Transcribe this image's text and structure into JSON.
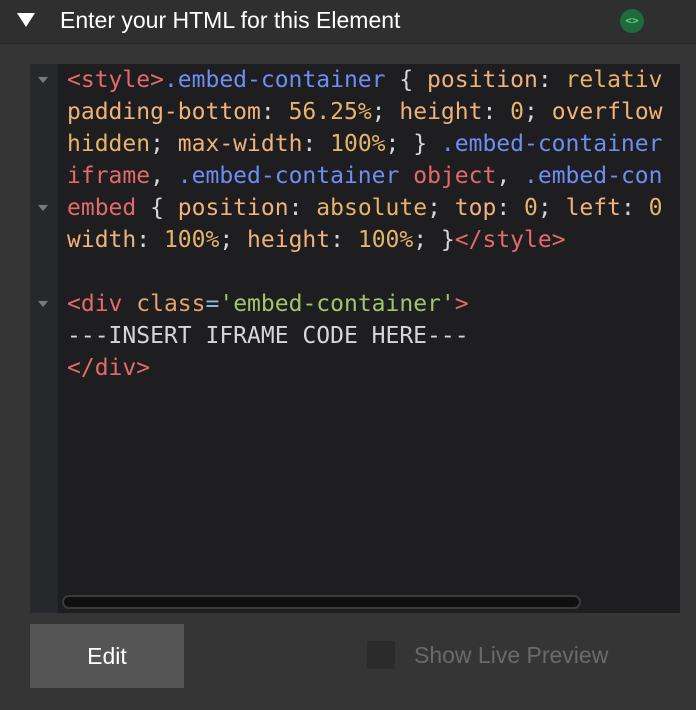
{
  "header": {
    "title": "Enter your HTML for this Element",
    "collapse_icon": "triangle-down-icon",
    "badge_icon": "code-brackets-icon",
    "badge_glyph": "<>",
    "badge_color": "#1f6b3c"
  },
  "editor": {
    "lines": [
      [
        {
          "t": "tag",
          "s": "<style>"
        },
        {
          "t": "cls",
          "s": ".embed-container"
        },
        {
          "t": "plain",
          "s": " { "
        },
        {
          "t": "prop",
          "s": "position"
        },
        {
          "t": "plain",
          "s": ": "
        },
        {
          "t": "val",
          "s": "relativ"
        }
      ],
      [
        {
          "t": "prop",
          "s": "padding-bottom"
        },
        {
          "t": "plain",
          "s": ": "
        },
        {
          "t": "val",
          "s": "56.25%"
        },
        {
          "t": "plain",
          "s": "; "
        },
        {
          "t": "prop",
          "s": "height"
        },
        {
          "t": "plain",
          "s": ": "
        },
        {
          "t": "val",
          "s": "0"
        },
        {
          "t": "plain",
          "s": "; "
        },
        {
          "t": "prop",
          "s": "overflow"
        }
      ],
      [
        {
          "t": "val",
          "s": "hidden"
        },
        {
          "t": "plain",
          "s": "; "
        },
        {
          "t": "prop",
          "s": "max-width"
        },
        {
          "t": "plain",
          "s": ": "
        },
        {
          "t": "val",
          "s": "100%"
        },
        {
          "t": "plain",
          "s": "; } "
        },
        {
          "t": "cls",
          "s": ".embed-container"
        }
      ],
      [
        {
          "t": "tag",
          "s": "iframe"
        },
        {
          "t": "plain",
          "s": ", "
        },
        {
          "t": "cls",
          "s": ".embed-container"
        },
        {
          "t": "plain",
          "s": " "
        },
        {
          "t": "tag",
          "s": "object"
        },
        {
          "t": "plain",
          "s": ", "
        },
        {
          "t": "cls",
          "s": ".embed-con"
        }
      ],
      [
        {
          "t": "tag",
          "s": "embed"
        },
        {
          "t": "plain",
          "s": " { "
        },
        {
          "t": "prop",
          "s": "position"
        },
        {
          "t": "plain",
          "s": ": "
        },
        {
          "t": "val",
          "s": "absolute"
        },
        {
          "t": "plain",
          "s": "; "
        },
        {
          "t": "prop",
          "s": "top"
        },
        {
          "t": "plain",
          "s": ": "
        },
        {
          "t": "val",
          "s": "0"
        },
        {
          "t": "plain",
          "s": "; "
        },
        {
          "t": "prop",
          "s": "left"
        },
        {
          "t": "plain",
          "s": ": "
        },
        {
          "t": "val",
          "s": "0"
        }
      ],
      [
        {
          "t": "prop",
          "s": "width"
        },
        {
          "t": "plain",
          "s": ": "
        },
        {
          "t": "val",
          "s": "100%"
        },
        {
          "t": "plain",
          "s": "; "
        },
        {
          "t": "prop",
          "s": "height"
        },
        {
          "t": "plain",
          "s": ": "
        },
        {
          "t": "val",
          "s": "100%"
        },
        {
          "t": "plain",
          "s": "; }"
        },
        {
          "t": "tag",
          "s": "</style>"
        }
      ],
      [],
      [
        {
          "t": "tag",
          "s": "<div"
        },
        {
          "t": "plain",
          "s": " "
        },
        {
          "t": "attr",
          "s": "class"
        },
        {
          "t": "op",
          "s": "="
        },
        {
          "t": "str",
          "s": "'embed-container'"
        },
        {
          "t": "tag",
          "s": ">"
        }
      ],
      [
        {
          "t": "plain",
          "s": "---INSERT IFRAME CODE HERE---"
        }
      ],
      [
        {
          "t": "tag",
          "s": "</div>"
        }
      ]
    ],
    "fold_markers": [
      0,
      4,
      7
    ],
    "fold_icon": "fold-arrow-icon"
  },
  "footer": {
    "edit_label": "Edit",
    "live_preview_label": "Show Live Preview",
    "live_preview_checked": false
  }
}
